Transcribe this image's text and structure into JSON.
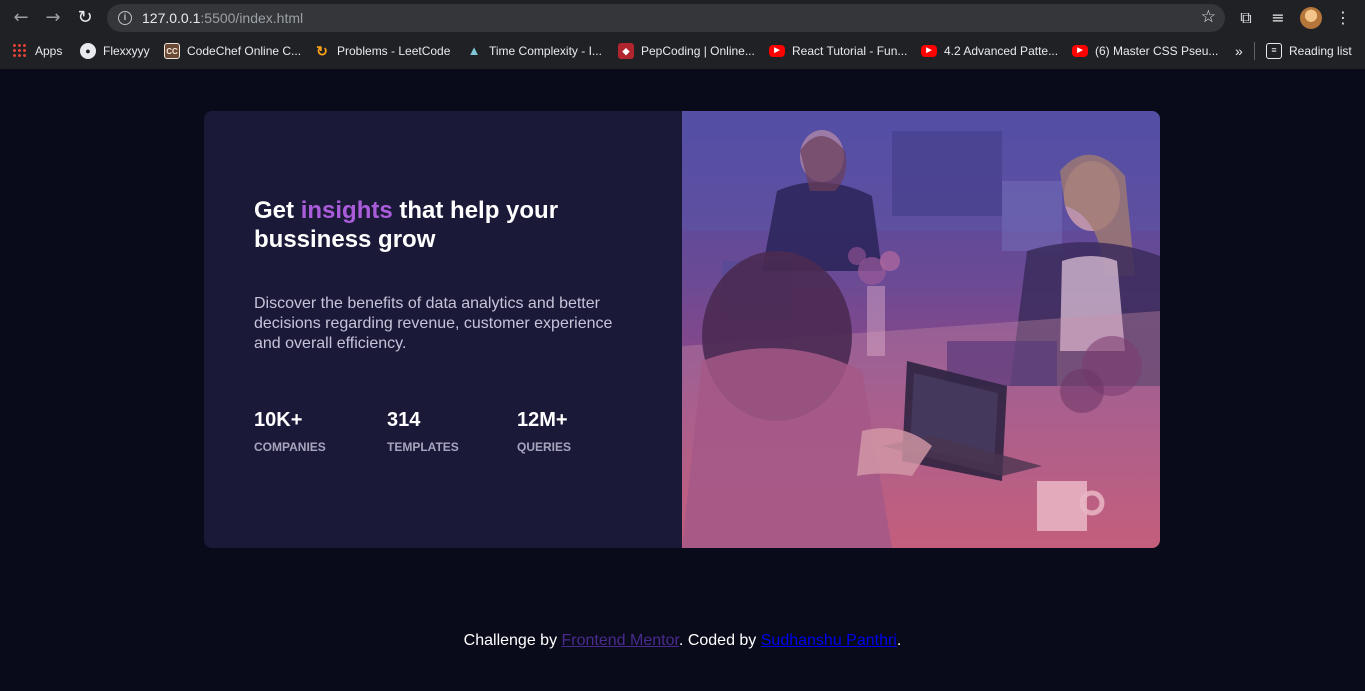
{
  "browser": {
    "url_host": "127.0.0.1",
    "url_rest": ":5500/index.html",
    "bookmarks": [
      {
        "label": "Apps",
        "icon": "apps-grid-icon"
      },
      {
        "label": "Flexxyyy",
        "icon": "github-icon"
      },
      {
        "label": "CodeChef Online C...",
        "icon": "codechef-icon"
      },
      {
        "label": "Problems - LeetCode",
        "icon": "leetcode-icon"
      },
      {
        "label": "Time Complexity - I...",
        "icon": "mountain-icon"
      },
      {
        "label": "PepCoding | Online...",
        "icon": "pepcoding-icon"
      },
      {
        "label": "React Tutorial - Fun...",
        "icon": "youtube-icon"
      },
      {
        "label": "4.2 Advanced Patte...",
        "icon": "youtube-icon"
      },
      {
        "label": "(6) Master CSS Pseu...",
        "icon": "youtube-icon"
      }
    ],
    "overflow_label": "»",
    "reading_list": "Reading list"
  },
  "card": {
    "headline_pre": "Get ",
    "headline_accent": "insights",
    "headline_post": " that help your bussiness grow",
    "description": "Discover the benefits of data analytics and better decisions regarding revenue, customer experience and overall efficiency.",
    "stats": [
      {
        "value": "10K+",
        "label": "COMPANIES"
      },
      {
        "value": "314",
        "label": "TEMPLATES"
      },
      {
        "value": "12M+",
        "label": "QUERIES"
      }
    ]
  },
  "footer": {
    "prefix": "Challenge by ",
    "link1": "Frontend Mentor",
    "middle": ". Coded by ",
    "link2": "Sudhanshu Panthri",
    "suffix": "."
  },
  "colors": {
    "page_bg": "#090b1a",
    "card_bg": "#1b1938",
    "accent": "#aa5cdb"
  }
}
